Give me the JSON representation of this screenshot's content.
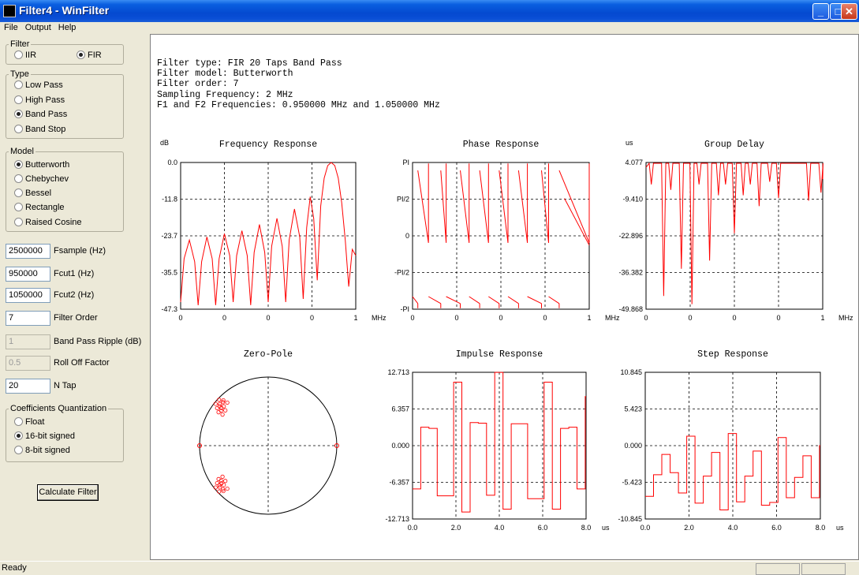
{
  "window": {
    "title": "Filter4 - WinFilter",
    "min": "_",
    "max": "□",
    "close": "✕"
  },
  "menu": [
    "File",
    "Output",
    "Help"
  ],
  "filter_group": {
    "legend": "Filter",
    "options": [
      "IIR",
      "FIR"
    ],
    "selected": "FIR"
  },
  "type_group": {
    "legend": "Type",
    "options": [
      "Low Pass",
      "High Pass",
      "Band Pass",
      "Band Stop"
    ],
    "selected": "Band Pass"
  },
  "model_group": {
    "legend": "Model",
    "options": [
      "Butterworth",
      "Chebychev",
      "Bessel",
      "Rectangle",
      "Raised Cosine"
    ],
    "selected": "Butterworth"
  },
  "params": [
    {
      "value": "2500000",
      "label": "Fsample (Hz)",
      "disabled": false
    },
    {
      "value": "950000",
      "label": "Fcut1 (Hz)",
      "disabled": false
    },
    {
      "value": "1050000",
      "label": "Fcut2 (Hz)",
      "disabled": false
    },
    {
      "value": "7",
      "label": "Filter Order",
      "disabled": false
    },
    {
      "value": "1",
      "label": "Band Pass Ripple (dB)",
      "disabled": true
    },
    {
      "value": "0.5",
      "label": "Roll Off Factor",
      "disabled": true
    },
    {
      "value": "20",
      "label": "N Tap",
      "disabled": false
    }
  ],
  "quant_group": {
    "legend": "Coefficients Quantization",
    "options": [
      "Float",
      "16-bit signed",
      "8-bit signed"
    ],
    "selected": "16-bit signed"
  },
  "calc_button": "Calculate Filter",
  "info_lines": [
    "Filter type: FIR 20 Taps Band Pass",
    "Filter model: Butterworth",
    "Filter order: 7",
    "Sampling Frequency: 2 MHz",
    "F1 and F2 Frequencies: 0.950000 MHz and 1.050000 MHz"
  ],
  "status": {
    "text": "Ready"
  },
  "colors": {
    "curve": "#ff0000",
    "grid": "#000000"
  },
  "chart_data": [
    {
      "type": "line",
      "title": "Frequency Response",
      "ylabel": "dB",
      "xlabel": "MHz",
      "yticks": [
        "0.0",
        "-11.8",
        "-23.7",
        "-35.5",
        "-47.3"
      ],
      "xticks": [
        "0",
        "0",
        "0",
        "0",
        "1"
      ],
      "ylim": [
        -47.3,
        0
      ],
      "xlim": [
        0,
        1
      ],
      "series": [
        {
          "x": [
            0,
            0.02,
            0.05,
            0.08,
            0.1,
            0.12,
            0.15,
            0.18,
            0.2,
            0.22,
            0.25,
            0.28,
            0.3,
            0.32,
            0.35,
            0.38,
            0.4,
            0.42,
            0.45,
            0.48,
            0.5,
            0.52,
            0.55,
            0.58,
            0.6,
            0.62,
            0.65,
            0.68,
            0.7,
            0.72,
            0.74,
            0.76,
            0.78,
            0.8,
            0.82,
            0.84,
            0.86,
            0.88,
            0.9,
            0.92,
            0.94,
            0.96,
            0.98,
            1.0
          ],
          "y": [
            -45,
            -31,
            -25,
            -32,
            -46,
            -32,
            -24,
            -31,
            -46,
            -31,
            -23,
            -30,
            -45,
            -30,
            -22,
            -30,
            -46,
            -29,
            -20,
            -29,
            -45,
            -27,
            -18,
            -27,
            -45,
            -25,
            -15,
            -24,
            -44,
            -21,
            -11,
            -18,
            -38,
            -14,
            -5,
            -1,
            0,
            -1,
            -5,
            -13,
            -25,
            -40,
            -28,
            -30
          ]
        }
      ]
    },
    {
      "type": "line",
      "title": "Phase Response",
      "xlabel": "MHz",
      "yticks": [
        "PI",
        "PI/2",
        "0",
        "-PI/2",
        "-PI"
      ],
      "xticks": [
        "0",
        "0",
        "0",
        "0",
        "1"
      ],
      "ylim": [
        -3.1416,
        3.1416
      ],
      "xlim": [
        0,
        1
      ]
    },
    {
      "type": "line",
      "title": "Group Delay",
      "ylabel": "us",
      "xlabel": "MHz",
      "yticks": [
        "4.077",
        "-9.410",
        "-22.896",
        "-36.382",
        "-49.868"
      ],
      "xticks": [
        "0",
        "0",
        "0",
        "0",
        "1"
      ],
      "ylim": [
        -49.868,
        4.077
      ],
      "xlim": [
        0,
        1
      ],
      "dips": [
        [
          0.03,
          -4
        ],
        [
          0.1,
          -45
        ],
        [
          0.14,
          -6
        ],
        [
          0.2,
          -35
        ],
        [
          0.26,
          -48
        ],
        [
          0.3,
          -4
        ],
        [
          0.36,
          -32
        ],
        [
          0.41,
          -8
        ],
        [
          0.45,
          -4
        ],
        [
          0.5,
          -22
        ],
        [
          0.55,
          -8
        ],
        [
          0.59,
          -4
        ],
        [
          0.64,
          -12
        ],
        [
          0.7,
          -3
        ],
        [
          0.75,
          -9
        ],
        [
          0.92,
          -10
        ],
        [
          0.99,
          -7
        ]
      ]
    },
    {
      "type": "scatter",
      "title": "Zero-Pole"
    },
    {
      "type": "line",
      "title": "Impulse Response",
      "xlabel": "us",
      "yticks": [
        "12.713",
        "6.357",
        "0.000",
        "-6.357",
        "-12.713"
      ],
      "xticks": [
        "0.0",
        "2.0",
        "4.0",
        "6.0",
        "8.0"
      ],
      "ylim": [
        -12.713,
        12.713
      ],
      "xlim": [
        0,
        8
      ],
      "values": [
        -7.5,
        3.2,
        3.0,
        -8.7,
        -8.7,
        11.0,
        -11.5,
        4.0,
        3.9,
        -8.6,
        12.7,
        -11.0,
        3.8,
        3.8,
        -9.2,
        -9.2,
        11.0,
        -11.0,
        3.0,
        3.2,
        -7.5,
        8.5
      ]
    },
    {
      "type": "line",
      "title": "Step Response",
      "xlabel": "us",
      "yticks": [
        "10.845",
        "5.423",
        "0.000",
        "-5.423",
        "-10.845"
      ],
      "xticks": [
        "0.0",
        "2.0",
        "4.0",
        "6.0",
        "8.0"
      ],
      "ylim": [
        -10.845,
        10.845
      ],
      "xlim": [
        0,
        8
      ],
      "values": [
        -7.5,
        -4.3,
        -1.3,
        -4.0,
        -7.0,
        1.4,
        -8.5,
        -4.5,
        -1.0,
        -9.5,
        1.8,
        -8.3,
        -4.5,
        -0.8,
        -8.8,
        -8.4,
        1.2,
        -7.7,
        -4.7,
        -1.5,
        -7.7,
        0.0
      ]
    }
  ]
}
